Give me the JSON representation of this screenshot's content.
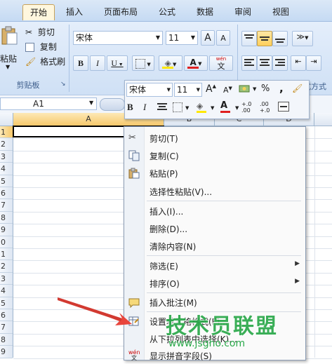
{
  "ribbon": {
    "tabs": [
      {
        "label": "开始",
        "active": true
      },
      {
        "label": "插入",
        "active": false
      },
      {
        "label": "页面布局",
        "active": false
      },
      {
        "label": "公式",
        "active": false
      },
      {
        "label": "数据",
        "active": false
      },
      {
        "label": "审阅",
        "active": false
      },
      {
        "label": "视图",
        "active": false
      }
    ],
    "clipboard": {
      "paste_label": "粘贴",
      "cut_label": "剪切",
      "copy_label": "复制",
      "format_painter_label": "格式刷",
      "group_label": "剪贴板"
    },
    "font": {
      "font_name": "宋体",
      "font_size": "11",
      "bold": "B",
      "italic": "I",
      "underline": "U",
      "grow": "A",
      "shrink": "A",
      "font_color_letter": "A",
      "phonetic": "wén",
      "phonetic_char": "文"
    },
    "number_group_label": "格式方式"
  },
  "formula_bar": {
    "name_box": "A1"
  },
  "grid": {
    "columns": [
      "A",
      "B",
      "C",
      "D"
    ],
    "rows": [
      "1",
      "2",
      "3",
      "4",
      "5",
      "6",
      "7",
      "8",
      "9",
      "0",
      "1",
      "2",
      "3",
      "4",
      "5",
      "6",
      "7",
      "8",
      "9"
    ]
  },
  "mini_toolbar": {
    "font_name": "宋体",
    "font_size": "11",
    "bold": "B",
    "italic": "I",
    "percent": "%",
    "comma": ",",
    "font_color_letter": "A",
    "increase_decimal": "+.0",
    "increase_decimal_sub": ".00",
    "decrease_decimal": ".00",
    "decrease_decimal_sub": "+.0"
  },
  "context_menu": {
    "items": [
      {
        "label": "剪切(T)",
        "icon": "scissors-icon",
        "submenu": false
      },
      {
        "label": "复制(C)",
        "icon": "copy-icon",
        "submenu": false
      },
      {
        "label": "粘贴(P)",
        "icon": "paste-icon",
        "submenu": false
      },
      {
        "label": "选择性粘贴(V)...",
        "icon": "",
        "submenu": false
      },
      {
        "label": "插入(I)...",
        "icon": "",
        "submenu": false
      },
      {
        "label": "删除(D)...",
        "icon": "",
        "submenu": false
      },
      {
        "label": "清除内容(N)",
        "icon": "",
        "submenu": false
      },
      {
        "label": "筛选(E)",
        "icon": "",
        "submenu": true
      },
      {
        "label": "排序(O)",
        "icon": "",
        "submenu": true
      },
      {
        "label": "插入批注(M)",
        "icon": "comment-icon",
        "submenu": false
      },
      {
        "label": "设置单元格格式(F)...",
        "icon": "format-cells-icon",
        "submenu": false
      },
      {
        "label": "从下拉列表中选择(K)...",
        "icon": "",
        "submenu": false
      },
      {
        "label": "显示拼音字段(S)",
        "icon": "phonetic-icon",
        "submenu": false
      }
    ]
  },
  "watermark": {
    "title": "技术员联盟",
    "url": "www.jsgho.com"
  },
  "colors": {
    "ribbon_bg": "#cfe0f5",
    "active_tab": "#fff7de",
    "column_a_header": "#f9d58a",
    "arrow": "#e8453c",
    "watermark_green": "#2aa84a"
  }
}
